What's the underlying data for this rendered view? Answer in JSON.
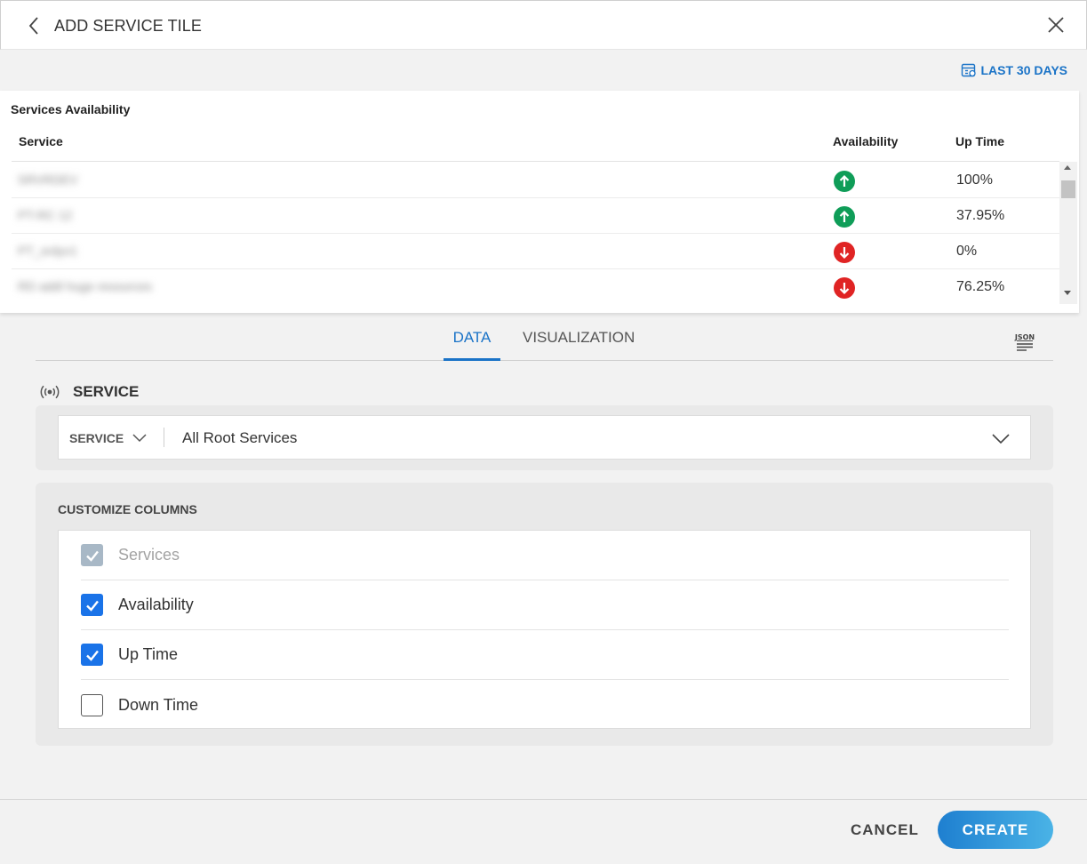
{
  "header": {
    "title": "ADD SERVICE TILE"
  },
  "time_range": {
    "label": "LAST 30 DAYS"
  },
  "tile": {
    "title": "Services Availability",
    "columns": {
      "service": "Service",
      "availability": "Availability",
      "up_time": "Up Time"
    },
    "rows": [
      {
        "service": "SRVRDEV",
        "status": "up",
        "up_time": "100%"
      },
      {
        "service": "PT-RC 12",
        "status": "up",
        "up_time": "37.95%"
      },
      {
        "service": "PT_srdyv1",
        "status": "down",
        "up_time": "0%"
      },
      {
        "service": "RD addl huge resources",
        "status": "down",
        "up_time": "76.25%"
      }
    ],
    "status_colors": {
      "up": "#0f9d58",
      "down": "#e02424"
    }
  },
  "tabs": {
    "data": "DATA",
    "visualization": "VISUALIZATION",
    "active": "data"
  },
  "service_section": {
    "heading": "SERVICE",
    "type_label": "SERVICE",
    "selected_value": "All Root Services"
  },
  "customize": {
    "title": "CUSTOMIZE COLUMNS",
    "options": [
      {
        "label": "Services",
        "state": "checked-disabled"
      },
      {
        "label": "Availability",
        "state": "checked"
      },
      {
        "label": "Up Time",
        "state": "checked"
      },
      {
        "label": "Down Time",
        "state": "unchecked"
      }
    ]
  },
  "footer": {
    "cancel": "CANCEL",
    "create": "CREATE"
  },
  "colors": {
    "accent": "#1a73c7",
    "checkbox": "#1a73e8"
  }
}
